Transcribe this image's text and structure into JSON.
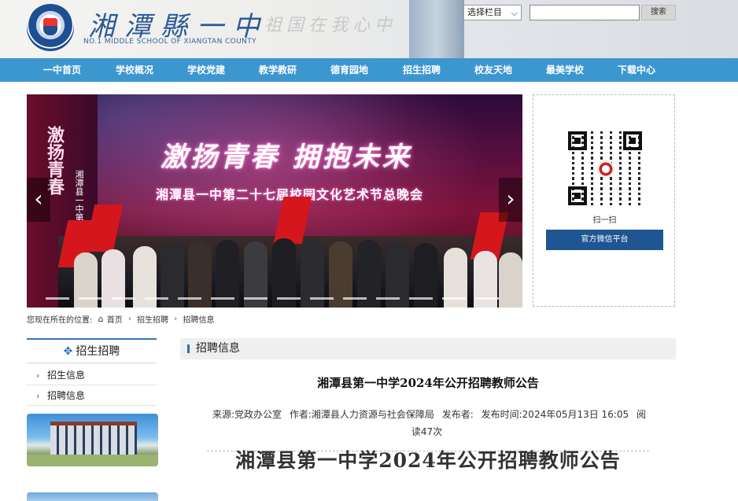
{
  "header": {
    "school_name": "湘潭縣一中",
    "school_name_en": "NO.1 MIDDLE SCHOOL OF XIANGTAN COUNTY",
    "slogan": "祖国在我心中",
    "search_select": "选择栏目",
    "search_placeholder": "",
    "search_button": "搜索"
  },
  "nav": {
    "items": [
      "一中首页",
      "学校概况",
      "学校党建",
      "教学教研",
      "德育园地",
      "招生招聘",
      "校友天地",
      "最美学校",
      "下载中心"
    ]
  },
  "banner": {
    "vertical_text": "激扬青春",
    "vertical_sub": "湘潭县一中第二十七届",
    "title": "激扬青春  拥抱未来",
    "subtitle": "湘潭县一中第二十七届校园文化艺术节总晚会",
    "prev": "‹",
    "next": "›"
  },
  "qr_panel": {
    "caption": "扫一扫",
    "button": "官方微信平台"
  },
  "breadcrumb": {
    "prefix": "您现在所在的位置:",
    "items": [
      "首页",
      "招生招聘",
      "招聘信息"
    ]
  },
  "sidebar": {
    "title": "招生招聘",
    "items": [
      "招生信息",
      "招聘信息"
    ]
  },
  "content": {
    "section_title": "招聘信息",
    "article_title": "湘潭县第一中学2024年公开招聘教师公告",
    "source": "来源:党政办公室",
    "author": "作者:湘潭县人力资源与社会保障局",
    "publisher": "发布者:",
    "publish_time": "发布时间:2024年05月13日 16:05",
    "reads": "阅读47次",
    "body_heading": "湘潭县第一中学2024年公开招聘教师公告"
  },
  "colors": {
    "nav_bg": "#3d97cf",
    "accent": "#2a6fb6",
    "wechat_button": "#1e5592"
  }
}
